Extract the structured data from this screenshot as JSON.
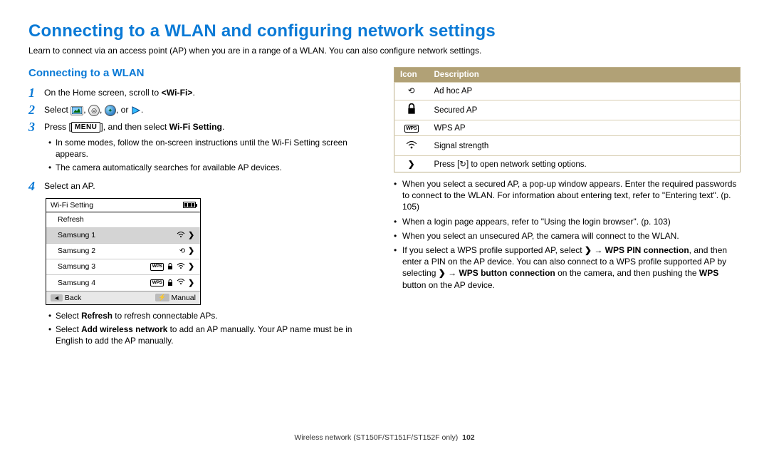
{
  "title": "Connecting to a WLAN and configuring network settings",
  "intro": "Learn to connect via an access point (AP) when you are in a range of a WLAN. You can also configure network settings.",
  "left": {
    "subhead": "Connecting to a WLAN",
    "step1_pre": "On the Home screen, scroll to ",
    "step1_wifi": "<Wi-Fi>",
    "step1_post": ".",
    "step2_pre": "Select ",
    "step2_post": ".",
    "or": ", or ",
    "comma": ", ",
    "step3_pre": "Press [",
    "step3_menu": "MENU",
    "step3_mid": "], and then select ",
    "step3_bold": "Wi-Fi Setting",
    "step3_post": ".",
    "step3_b1": "In some modes, follow the on-screen instructions until the Wi-Fi Setting screen appears.",
    "step3_b2": "The camera automatically searches for available AP devices.",
    "step4": "Select an AP.",
    "step4_b1_pre": "Select ",
    "step4_b1_bold": "Refresh",
    "step4_b1_post": " to refresh connectable APs.",
    "step4_b2_pre": "Select ",
    "step4_b2_bold": "Add wireless network",
    "step4_b2_post": " to add an AP manually. Your AP name must be in English to add the AP manually."
  },
  "wifi": {
    "title": "Wi-Fi Setting",
    "refresh": "Refresh",
    "ap1": "Samsung 1",
    "ap2": "Samsung 2",
    "ap3": "Samsung 3",
    "ap4": "Samsung 4",
    "back": "Back",
    "manual": "Manual",
    "wps": "WPS"
  },
  "right": {
    "th_icon": "Icon",
    "th_desc": "Description",
    "r1": "Ad hoc AP",
    "r2": "Secured AP",
    "r3": "WPS AP",
    "r4": "Signal strength",
    "r5_pre": "Press [",
    "r5_post": "] to open network setting options.",
    "b1": "When you select a secured AP, a pop-up window appears. Enter the required passwords to connect to the WLAN. For information about entering text, refer to \"Entering text\". (p. 105)",
    "b2": "When a login page appears, refer to \"Using the login browser\". (p. 103)",
    "b3": "When you select an unsecured AP, the camera will connect to the WLAN.",
    "b4_pre": "If you select a WPS profile supported AP, select ",
    "b4_arrow": " → ",
    "b4_bold1": "WPS PIN connection",
    "b4_mid": ", and then enter a PIN on the AP device. You can also connect to a WPS profile supported AP by selecting ",
    "b4_bold2": "WPS button connection",
    "b4_mid2": " on the camera, and then pushing the ",
    "b4_bold3": "WPS",
    "b4_end": " button on the AP device."
  },
  "footer": {
    "text": "Wireless network  (ST150F/ST151F/ST152F only)",
    "page": "102"
  }
}
